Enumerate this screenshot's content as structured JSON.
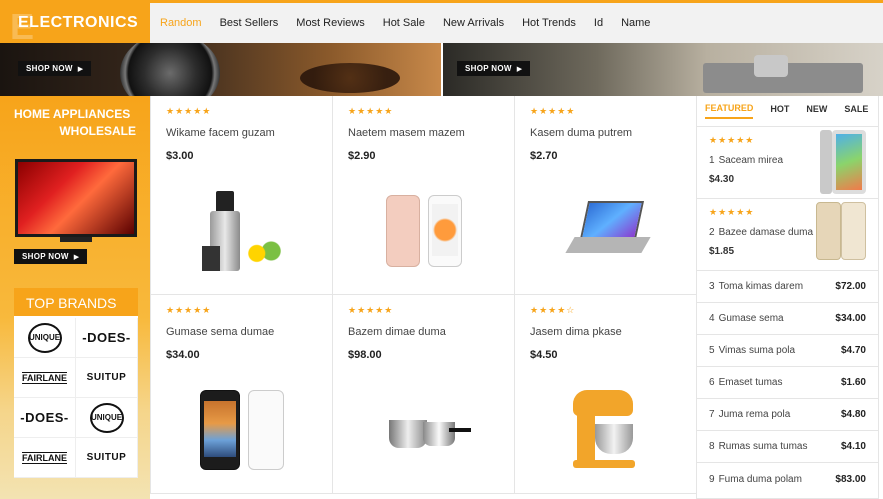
{
  "header": {
    "category_title": "ELECTRONICS",
    "tabs": [
      "Random",
      "Best Sellers",
      "Most Reviews",
      "Hot Sale",
      "New Arrivals",
      "Hot Trends",
      "Id",
      "Name"
    ],
    "active_tab": "Random"
  },
  "banners": {
    "left_button": "SHOP NOW",
    "right_button": "SHOP NOW"
  },
  "sidebar": {
    "title_line1": "HOME APPLIANCES",
    "title_line2": "WHOLESALE",
    "shop_button": "SHOP NOW",
    "brands_title": "TOP BRANDS",
    "brands": [
      "UNIQUE",
      "-DOES-",
      "FAIRLANE",
      "SUITUP",
      "-DOES-",
      "UNIQUE",
      "FAIRLANE",
      "SUITUP"
    ]
  },
  "products": [
    {
      "name": "Wikame facem guzam",
      "price": "$3.00",
      "stars": "★★★★★",
      "image": "juicer-icon"
    },
    {
      "name": "Naetem masem mazem",
      "price": "$2.90",
      "stars": "★★★★★",
      "image": "iphone-icon"
    },
    {
      "name": "Kasem duma putrem",
      "price": "$2.70",
      "stars": "★★★★★",
      "image": "laptop-icon"
    },
    {
      "name": "Gumase sema dumae",
      "price": "$34.00",
      "stars": "★★★★★",
      "image": "smartphone-icon"
    },
    {
      "name": "Bazem dimae duma",
      "price": "$98.00",
      "stars": "★★★★★",
      "image": "cookware-icon"
    },
    {
      "name": "Jasem dima pkase",
      "price": "$4.50",
      "stars": "★★★★☆",
      "image": "stand-mixer-icon"
    }
  ],
  "right_panel": {
    "tabs": [
      "FEATURED",
      "HOT",
      "NEW",
      "SALE"
    ],
    "active_tab": "FEATURED",
    "featured": [
      {
        "index": "1",
        "name": "Saceam mirea",
        "price": "$4.30",
        "stars": "★★★★★",
        "image": "ipad-icon"
      },
      {
        "index": "2",
        "name": "Bazee damase duma",
        "price": "$1.85",
        "stars": "★★★★★",
        "image": "galaxy-phone-icon"
      }
    ],
    "list": [
      {
        "index": "3",
        "name": "Toma kimas darem",
        "price": "$72.00"
      },
      {
        "index": "4",
        "name": "Gumase sema",
        "price": "$34.00"
      },
      {
        "index": "5",
        "name": "Vimas suma pola",
        "price": "$4.70"
      },
      {
        "index": "6",
        "name": "Emaset tumas",
        "price": "$1.60"
      },
      {
        "index": "7",
        "name": "Juma rema pola",
        "price": "$4.80"
      },
      {
        "index": "8",
        "name": "Rumas suma tumas",
        "price": "$4.10"
      },
      {
        "index": "9",
        "name": "Fuma duma polam",
        "price": "$83.00"
      }
    ]
  },
  "colors": {
    "accent": "#f7a41a",
    "tab_bar": "#f2f2f2",
    "button": "#111111"
  }
}
